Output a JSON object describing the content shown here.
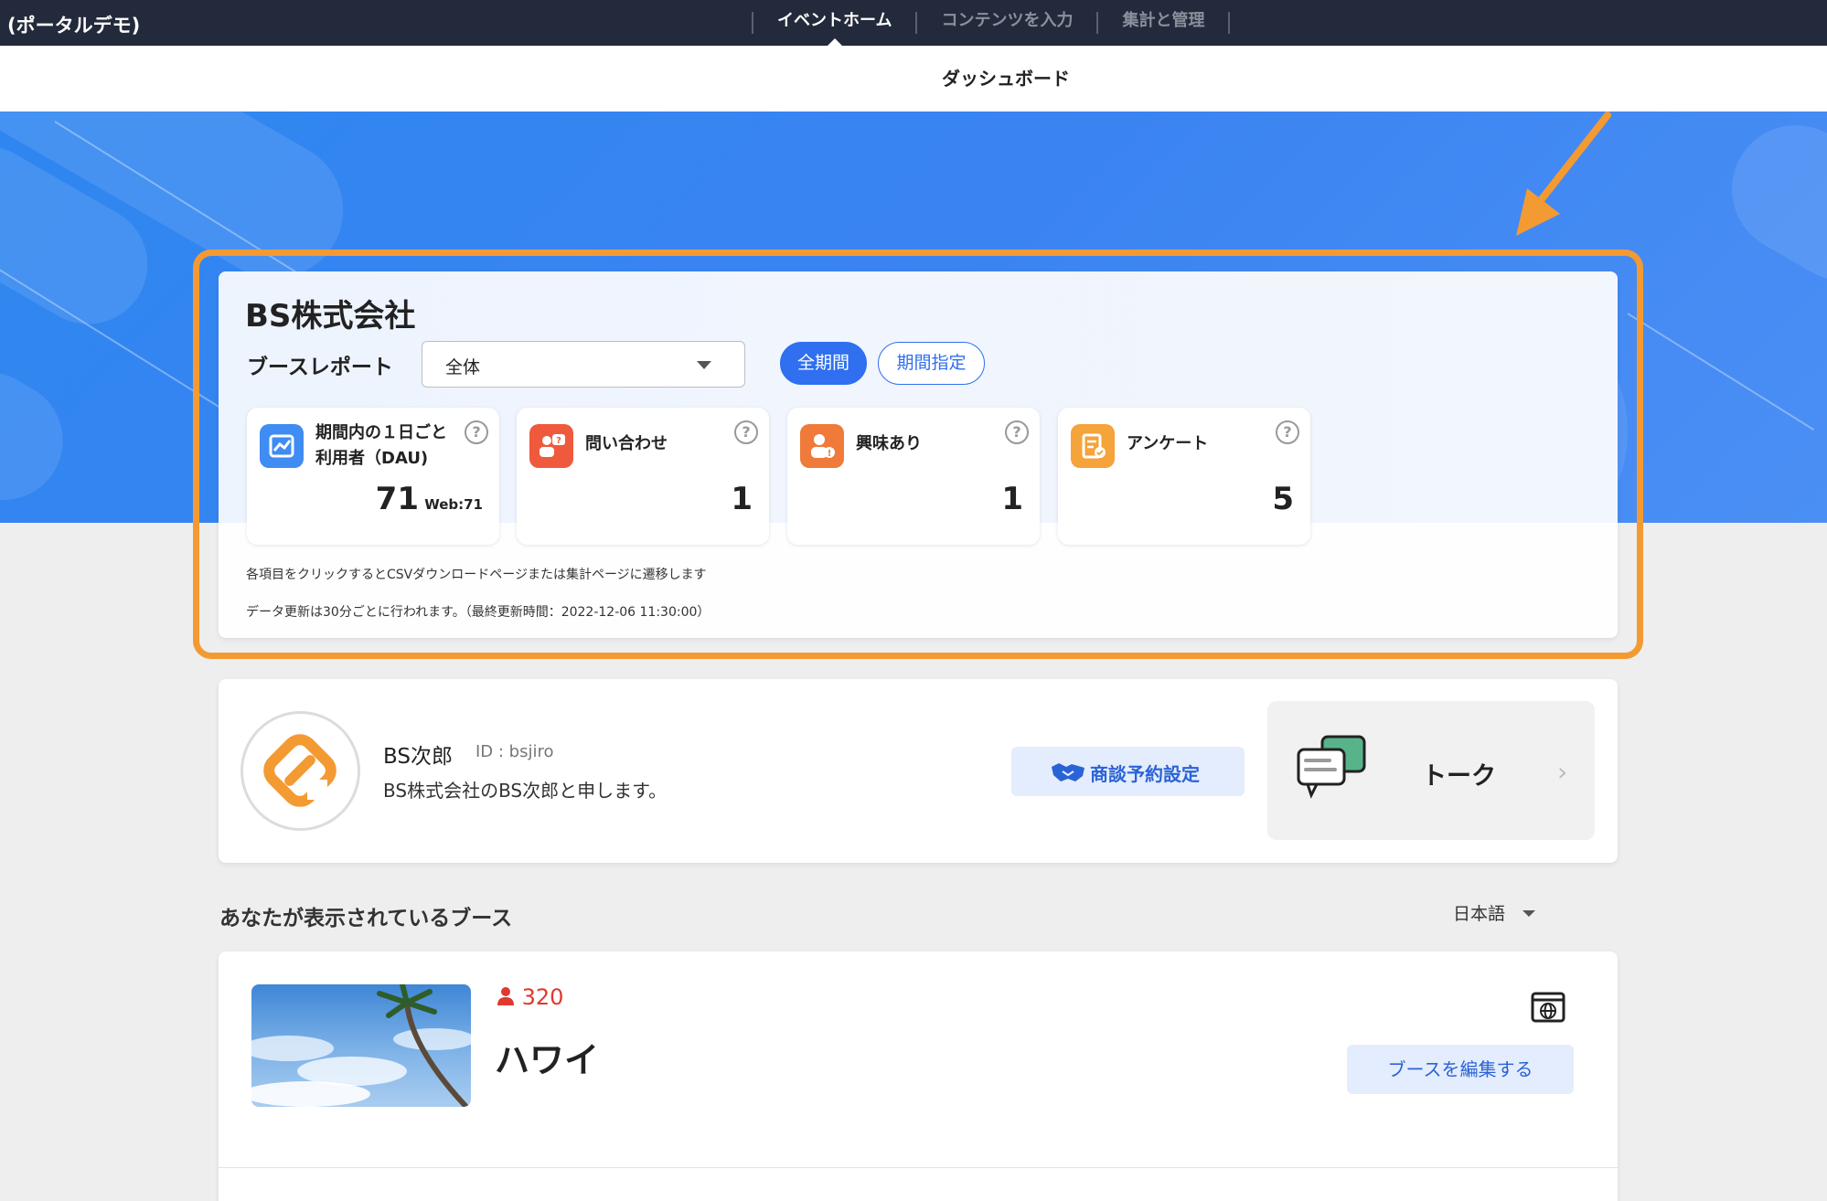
{
  "topnav": {
    "portal_title": "(ポータルデモ)",
    "tabs": [
      {
        "label": "イベントホーム",
        "active": true
      },
      {
        "label": "コンテンツを入力",
        "active": false
      },
      {
        "label": "集計と管理",
        "active": false
      }
    ]
  },
  "subbar": {
    "title": "ダッシュボード"
  },
  "report": {
    "company": "BS株式会社",
    "label": "ブースレポート",
    "select_value": "全体",
    "period_all": "全期間",
    "period_range": "期間指定",
    "stats": [
      {
        "label_line1": "期間内の１日ごと",
        "label_line2": "利用者（DAU)",
        "value": "71",
        "sub": "Web:71",
        "icon": "trend-chart-icon",
        "color": "#3f8cf2"
      },
      {
        "label_line1": "問い合わせ",
        "label_line2": "",
        "value": "1",
        "sub": "",
        "icon": "inquiry-icon",
        "color": "#ef5a3c"
      },
      {
        "label_line1": "興味あり",
        "label_line2": "",
        "value": "1",
        "sub": "",
        "icon": "interest-icon",
        "color": "#f07a3a"
      },
      {
        "label_line1": "アンケート",
        "label_line2": "",
        "value": "5",
        "sub": "",
        "icon": "survey-icon",
        "color": "#f5a33b"
      }
    ],
    "note_click": "各項目をクリックするとCSVダウンロードページまたは集計ページに遷移します",
    "note_update": "データ更新は30分ごとに行われます。（最終更新時間：2022-12-06 11:30:00）"
  },
  "profile": {
    "name": "BS次郎",
    "id_text": "ID : bsjiro",
    "description": "BS株式会社のBS次郎と申します。",
    "meeting_button": "商談予約設定",
    "talk_label": "トーク"
  },
  "section": {
    "title": "あなたが表示されているブース",
    "language": "日本語"
  },
  "booth": {
    "viewer_count": "320",
    "name": "ハワイ",
    "edit_button": "ブースを編集する"
  },
  "colors": {
    "accent": "#2f6ff0",
    "highlight": "#f39a32",
    "nav_bg": "#232a3b",
    "banner": "#3a84f2"
  }
}
